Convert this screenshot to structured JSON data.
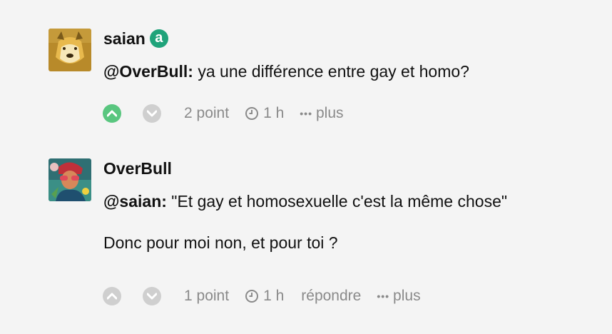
{
  "comments": [
    {
      "username": "saian",
      "badge": "a",
      "mention": "@OverBull:",
      "text": " ya une différence entre gay et homo?",
      "points": "2 point",
      "time": "1 h",
      "more": "plus"
    },
    {
      "username": "OverBull",
      "mention": "@saian:",
      "text": " \"Et gay et homosexuelle c'est la même chose\"",
      "paragraph2": "Donc pour moi non, et pour toi ?",
      "points": "1 point",
      "time": "1 h",
      "reply": "répondre",
      "more": "plus"
    }
  ],
  "colors": {
    "badge": "#1fa37a",
    "upvote_active": "#59c67f",
    "vote_inactive": "#cfcfcf",
    "meta_text": "#8a8a8a"
  },
  "icons": [
    "upvote-icon",
    "downvote-icon",
    "clock-icon",
    "more-dots-icon"
  ]
}
